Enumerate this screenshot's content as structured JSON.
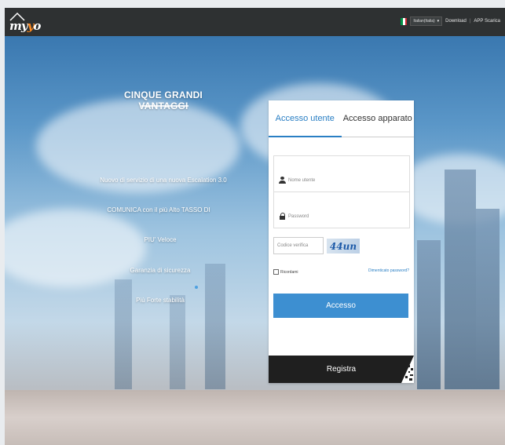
{
  "header": {
    "logo": {
      "part1": "my",
      "part2": "y",
      "part3": "o"
    },
    "language": "Italian(Italia)",
    "links": [
      "Download",
      "APP Scarica"
    ]
  },
  "hero": {
    "headline": "CINQUE GRANDI VANTAGGI",
    "features": [
      "Nuovo di servizio di una nuova Escalation 3.0",
      "COMUNICA con il più Alto TASSO DI",
      "PIU' Veloce",
      "Garanzia di sicurezza",
      "Più Forte stabilità"
    ]
  },
  "login": {
    "tabs": [
      "Accesso utente",
      "Accesso apparato"
    ],
    "username_placeholder": "Nome utente",
    "password_placeholder": "Password",
    "code_placeholder": "Codice verifica",
    "captcha_text": "44un",
    "remember_label": "Ricordami",
    "forgot_link": "Dimenticato password?",
    "login_button": "Accesso",
    "register_button": "Registra"
  },
  "colors": {
    "accent": "#3d8fd1",
    "topbar": "#2e3132"
  }
}
